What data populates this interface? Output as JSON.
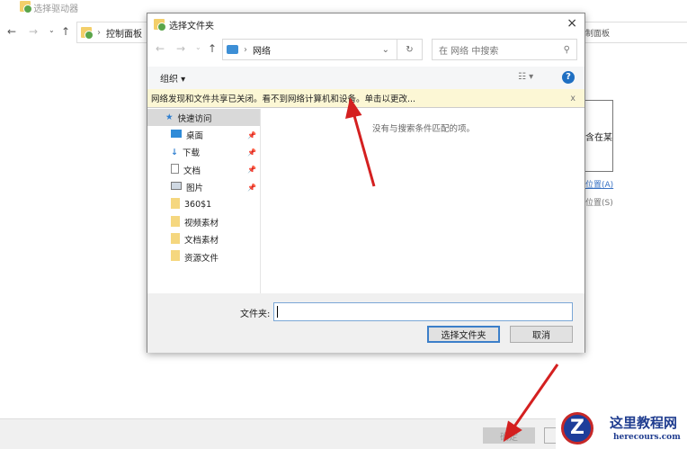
{
  "background": {
    "title": "选择驱动器",
    "breadcrumb": "控制面板",
    "breadcrumb_right": "制面板",
    "box_text": "含在某",
    "link_a": "位置(A)",
    "link_s": "位置(S)",
    "ok_button": "确定"
  },
  "dialog": {
    "title": "选择文件夹",
    "close": "×",
    "address": "网络",
    "search_placeholder": "在 网络 中搜索",
    "organize": "组织 ▾",
    "info_bar": "网络发现和文件共享已关闭。看不到网络计算机和设备。单击以更改...",
    "info_close": "x",
    "empty_message": "没有与搜索条件匹配的项。",
    "nav_items": [
      {
        "label": "快速访问",
        "icon": "star"
      },
      {
        "label": "桌面",
        "icon": "desktop",
        "pinned": true
      },
      {
        "label": "下载",
        "icon": "download",
        "pinned": true
      },
      {
        "label": "文档",
        "icon": "document",
        "pinned": true
      },
      {
        "label": "图片",
        "icon": "picture",
        "pinned": true
      },
      {
        "label": "360$1",
        "icon": "folder"
      },
      {
        "label": "视频素材",
        "icon": "folder"
      },
      {
        "label": "文档素材",
        "icon": "folder"
      },
      {
        "label": "资源文件",
        "icon": "folder"
      }
    ],
    "folder_label": "文件夹:",
    "folder_value": "",
    "select_button": "选择文件夹",
    "cancel_button": "取消"
  },
  "watermark": {
    "name": "这里教程网",
    "url": "herecours.com"
  }
}
